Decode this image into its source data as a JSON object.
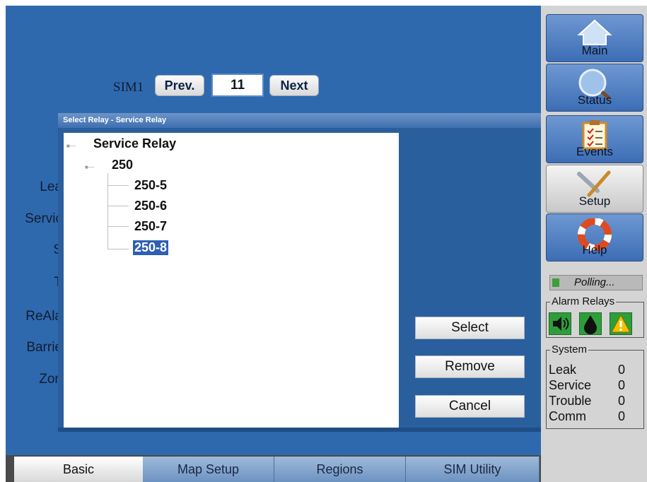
{
  "sim": {
    "label": "SIM1",
    "prev": "Prev.",
    "value": "11",
    "next": "Next"
  },
  "background_labels": [
    "Lea",
    "Servic",
    "S",
    "T",
    "ReAla",
    "Barrie",
    "Zon"
  ],
  "dialog": {
    "title": "Select Relay - Service Relay",
    "tree": {
      "root": "Service Relay",
      "group": "250",
      "children": [
        "250-5",
        "250-6",
        "250-7",
        "250-8"
      ],
      "selected": "250-8"
    },
    "buttons": {
      "select": "Select",
      "remove": "Remove",
      "cancel": "Cancel"
    }
  },
  "tabs": [
    {
      "label": "Basic",
      "active": true
    },
    {
      "label": "Map Setup",
      "active": false
    },
    {
      "label": "Regions",
      "active": false
    },
    {
      "label": "SIM Utility",
      "active": false
    }
  ],
  "nav": [
    {
      "label": "Main",
      "icon": "home-icon"
    },
    {
      "label": "Status",
      "icon": "magnifier-icon"
    },
    {
      "label": "Events",
      "icon": "clipboard-icon"
    },
    {
      "label": "Setup",
      "icon": "wrench-screwdriver-icon",
      "active": true
    },
    {
      "label": "Help",
      "icon": "lifebuoy-icon"
    }
  ],
  "polling": "Polling...",
  "alarm_relays": {
    "title": "Alarm Relays",
    "icons": [
      "speaker-icon",
      "drop-icon",
      "warning-icon"
    ]
  },
  "system": {
    "title": "System",
    "rows": [
      {
        "label": "Leak",
        "value": "0"
      },
      {
        "label": "Service",
        "value": "0"
      },
      {
        "label": "Trouble",
        "value": "0"
      },
      {
        "label": "Comm",
        "value": "0"
      }
    ]
  },
  "colors": {
    "accent": "#2f69ad",
    "selection": "#2f5fb4",
    "alarm_green": "#2e9e3a",
    "warning_yellow": "#f2c200"
  }
}
